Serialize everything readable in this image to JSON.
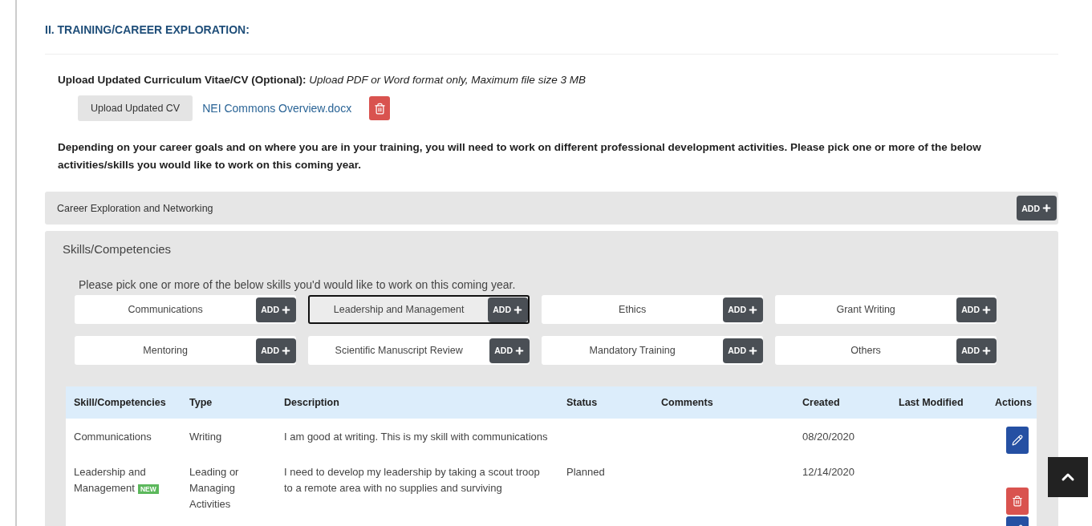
{
  "section_title": "II. TRAINING/CAREER EXPLORATION:",
  "upload": {
    "label": "Upload Updated Curriculum Vitae/CV (Optional):",
    "hint": "Upload PDF or Word format only, Maximum file size 3 MB",
    "button": "Upload Updated CV",
    "file_name": "NEI Commons Overview.docx"
  },
  "intro": "Depending on your career goals and on where you are in your training, you will need to work on different professional development activities. Please pick one or more of the below activities/skills you would like to work on this coming year.",
  "career_bar": {
    "label": "Career Exploration and Networking",
    "add": "ADD"
  },
  "skills_panel": {
    "title": "Skills/Competencies",
    "instruction": "Please pick one or more of the below skills you'd would like to work on this coming year.",
    "skills": [
      {
        "label": "Communications",
        "add": "ADD",
        "selected": false
      },
      {
        "label": "Leadership and Management",
        "add": "ADD",
        "selected": true
      },
      {
        "label": "Ethics",
        "add": "ADD",
        "selected": false
      },
      {
        "label": "Grant Writing",
        "add": "ADD",
        "selected": false
      },
      {
        "label": "Mentoring",
        "add": "ADD",
        "selected": false
      },
      {
        "label": "Scientific Manuscript Review",
        "add": "ADD",
        "selected": false
      },
      {
        "label": "Mandatory Training",
        "add": "ADD",
        "selected": false
      },
      {
        "label": "Others",
        "add": "ADD",
        "selected": false
      }
    ]
  },
  "table": {
    "columns": [
      "Skill/Competencies",
      "Type",
      "Description",
      "Status",
      "Comments",
      "Created",
      "Last Modified",
      "Actions"
    ],
    "rows": [
      {
        "skill": "Communications",
        "type": "Writing",
        "description": "I am good at writing. This is my skill with communications",
        "created": "08/20/2020",
        "actions": [
          {
            "kind": "edit"
          }
        ]
      },
      {
        "skill": "Leadership and Management",
        "badge": "NEW",
        "type": "Leading or Managing Activities",
        "description": "I need to develop my leadership by taking a scout troop to a remote area with no supplies and surviving",
        "status": "Planned",
        "created": "12/14/2020",
        "actions": [
          {
            "kind": "delete"
          },
          {
            "kind": "edit"
          }
        ]
      }
    ]
  }
}
